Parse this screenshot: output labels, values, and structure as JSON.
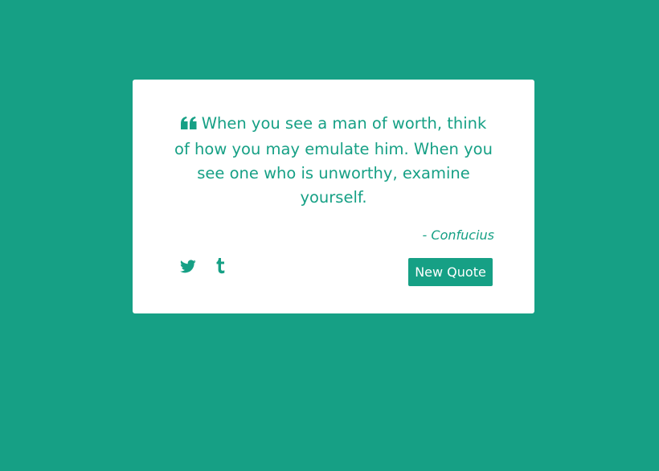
{
  "colors": {
    "background": "#16a085",
    "card": "#ffffff",
    "accent": "#16a085",
    "button_text": "#ffffff"
  },
  "quote": {
    "icon": "quote-left-icon",
    "text": "When you see a man of worth, think of how you may emulate him. When you see one who is unworthy, examine yourself.",
    "author": "- Confucius"
  },
  "share": {
    "twitter_icon": "twitter-icon",
    "tumblr_icon": "tumblr-icon"
  },
  "actions": {
    "new_quote_label": "New Quote"
  }
}
